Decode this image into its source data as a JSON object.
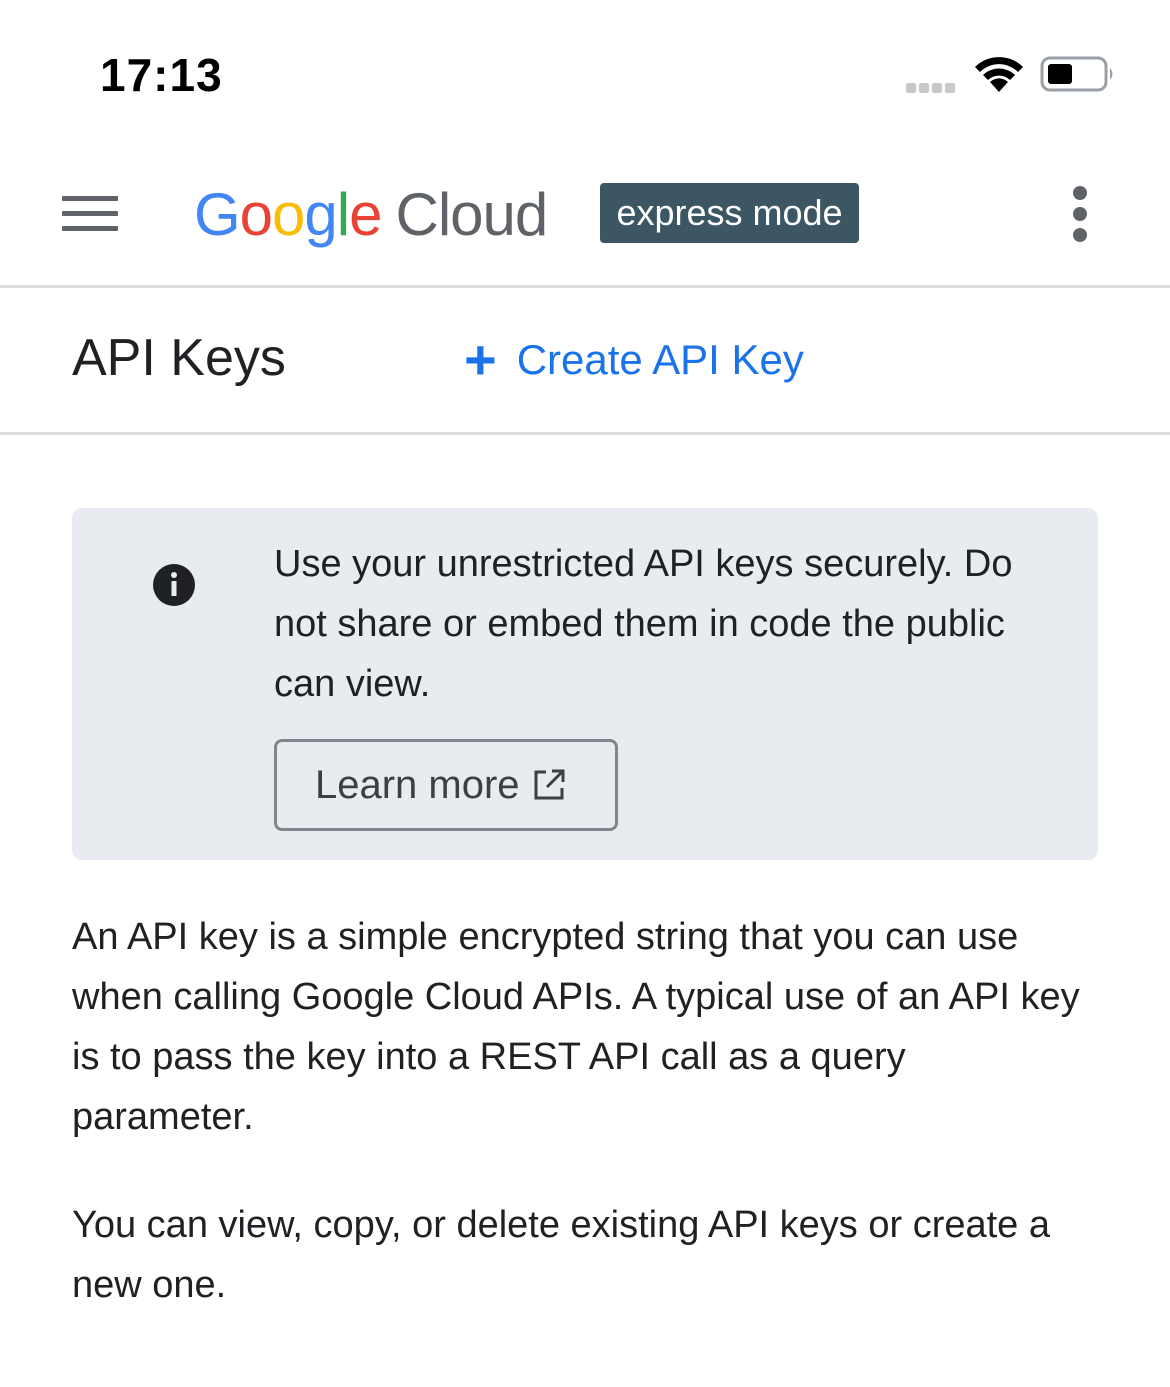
{
  "status_bar": {
    "time": "17:13"
  },
  "app_bar": {
    "logo": {
      "g1": "G",
      "o1": "o",
      "o2": "o",
      "g2": "g",
      "l": "l",
      "e": "e",
      "cloud": "Cloud"
    },
    "badge": "express mode"
  },
  "header": {
    "title": "API Keys",
    "create_label": "Create API Key"
  },
  "banner": {
    "message": "Use your unrestricted API keys securely. Do not share or embed them in code the public can view.",
    "learn_more_label": "Learn more"
  },
  "content": {
    "paragraph1": "An API key is a simple encrypted string that you can use when calling Google Cloud APIs. A typical use of an API key is to pass the key into a REST API call as a query parameter.",
    "paragraph2": "You can view, copy, or delete existing API keys or create a new one."
  },
  "colors": {
    "accent": "#1a73e8",
    "badge_bg": "#3c5663",
    "banner_bg": "#e8ebf0",
    "divider": "#dadce0"
  }
}
